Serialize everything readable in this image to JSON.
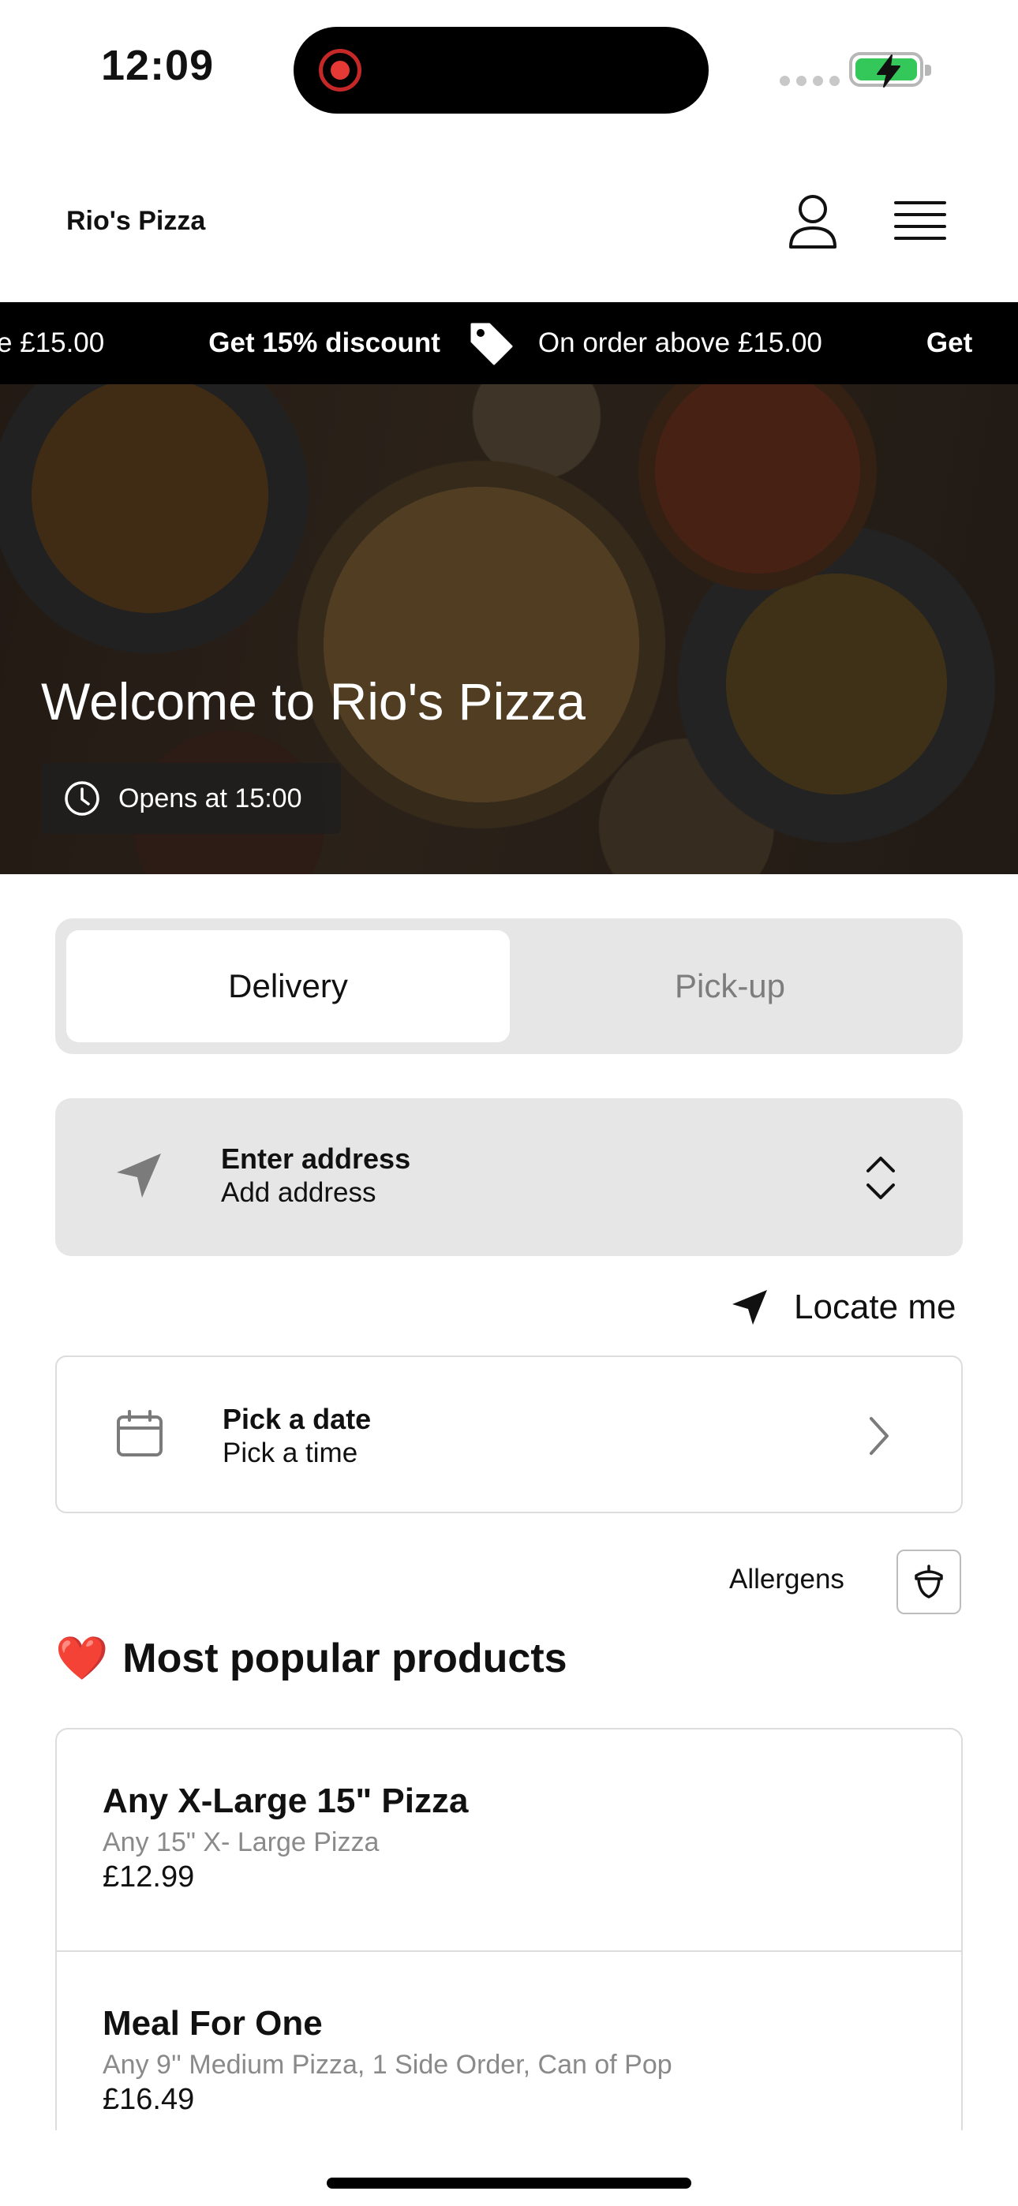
{
  "status_bar": {
    "time": "12:09"
  },
  "header": {
    "brand": "Rio's Pizza"
  },
  "promo": {
    "tail_text": "e £15.00",
    "discount_text": "Get 15% discount",
    "condition_text": "On order above £15.00",
    "next_text": "Get"
  },
  "hero": {
    "title": "Welcome to Rio's Pizza",
    "hours": "Opens at 15:00"
  },
  "order_mode": {
    "delivery_label": "Delivery",
    "pickup_label": "Pick-up",
    "selected": "Delivery"
  },
  "address": {
    "title": "Enter address",
    "subtitle": "Add address",
    "locate_label": "Locate me"
  },
  "schedule": {
    "title": "Pick a date",
    "subtitle": "Pick a time"
  },
  "allergens": {
    "label": "Allergens"
  },
  "popular": {
    "emoji": "❤️",
    "title": "Most popular products",
    "items": [
      {
        "name": "Any X-Large 15\" Pizza",
        "description": "Any 15\" X- Large Pizza",
        "price": "£12.99"
      },
      {
        "name": "Meal For One",
        "description": "Any 9'' Medium Pizza, 1 Side Order, Can of Pop",
        "price": "£16.49"
      }
    ]
  },
  "colors": {
    "ticker_bg": "#000000",
    "segment_bg": "#e6e6e6",
    "battery_green": "#34c759"
  }
}
